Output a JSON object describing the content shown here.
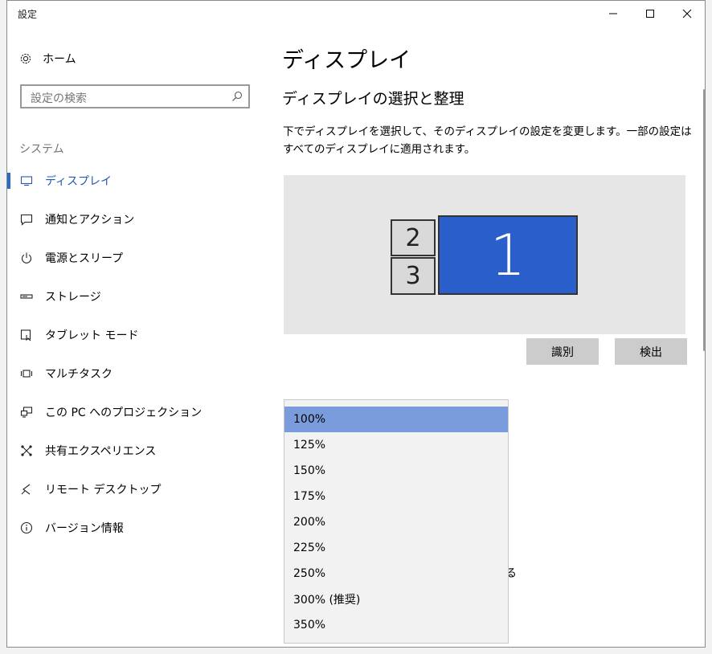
{
  "window": {
    "title": "設定"
  },
  "titlebar": {
    "minimize_icon": "minimize-icon",
    "maximize_icon": "maximize-icon",
    "close_icon": "close-icon"
  },
  "sidebar": {
    "home_label": "ホーム",
    "search_placeholder": "設定の検索",
    "section_heading": "システム",
    "items": [
      {
        "label": "ディスプレイ",
        "icon": "monitor-icon"
      },
      {
        "label": "通知とアクション",
        "icon": "notification-icon"
      },
      {
        "label": "電源とスリープ",
        "icon": "power-icon"
      },
      {
        "label": "ストレージ",
        "icon": "storage-icon"
      },
      {
        "label": "タブレット モード",
        "icon": "tablet-icon"
      },
      {
        "label": "マルチタスク",
        "icon": "multitask-icon"
      },
      {
        "label": "この PC へのプロジェクション",
        "icon": "projection-icon"
      },
      {
        "label": "共有エクスペリエンス",
        "icon": "shared-experience-icon"
      },
      {
        "label": "リモート デスクトップ",
        "icon": "remote-desktop-icon"
      },
      {
        "label": "バージョン情報",
        "icon": "info-icon"
      }
    ],
    "active_index": 0
  },
  "main": {
    "title": "ディスプレイ",
    "subtitle": "ディスプレイの選択と整理",
    "description": "下でディスプレイを選択して、そのディスプレイの設定を変更します。一部の設定はすべてのディスプレイに適用されます。",
    "monitors": [
      {
        "label": "1"
      },
      {
        "label": "2"
      },
      {
        "label": "3"
      }
    ],
    "identify_label": "識別",
    "detect_label": "検出",
    "partial_text": "る"
  },
  "scale_dropdown": {
    "options": [
      "100%",
      "125%",
      "150%",
      "175%",
      "200%",
      "225%",
      "250%",
      "300% (推奨)",
      "350%"
    ],
    "selected_index": 0
  },
  "colors": {
    "accent": "#2a6acd",
    "monitor_primary": "#2a5fcb",
    "selected_option": "#7b9cdc"
  }
}
